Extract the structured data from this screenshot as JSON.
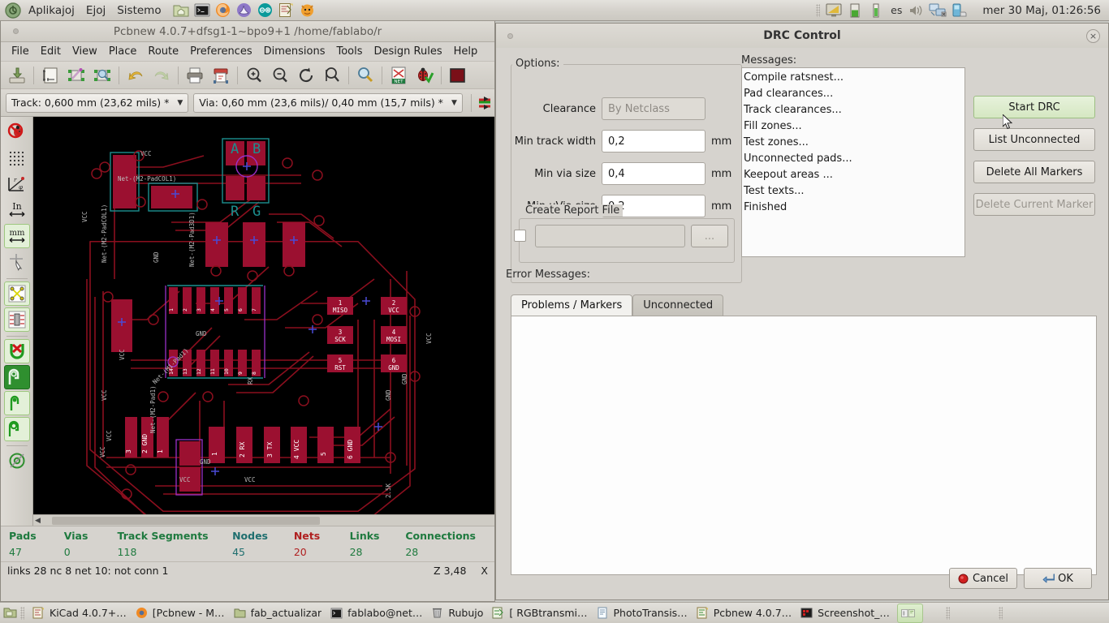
{
  "desktop": {
    "panel": {
      "menus": [
        "Aplikajoj",
        "Ejoj",
        "Sistemo"
      ],
      "launchers": [
        "file-manager-icon",
        "terminal-icon",
        "firefox-icon",
        "inkscape-icon",
        "arduino-icon",
        "kicad-icon",
        "scratch-icon"
      ],
      "tray": [
        "display-icon",
        "battery-icon",
        "power-icon"
      ],
      "keyboard_layout": "es",
      "tray_right": [
        "volume-icon",
        "network-icon",
        "printer-icon"
      ],
      "clock": "mer 30 Maj, 01:26:56"
    }
  },
  "pcbnew": {
    "title": "Pcbnew 4.0.7+dfsg1-1~bpo9+1 /home/fablabo/r",
    "menu": [
      "File",
      "Edit",
      "View",
      "Place",
      "Route",
      "Preferences",
      "Dimensions",
      "Tools",
      "Design Rules",
      "Help"
    ],
    "toolbar": [
      "save-board-icon",
      "board-setup-icon",
      "module-editor-icon",
      "module-viewer-icon",
      "undo-icon",
      "redo-icon",
      "print-icon",
      "plot-icon",
      "zoom-in-icon",
      "zoom-out-icon",
      "zoom-redraw-icon",
      "zoom-fit-icon",
      "find-icon",
      "netlist-icon",
      "drc-icon",
      "layer-color-icon"
    ],
    "track_selector": "Track: 0,600 mm (23,62 mils) *",
    "via_selector": "Via: 0,60 mm (23,6 mils)/ 0,40 mm (15,7 mils) *",
    "left_tools": [
      "drc-off-icon",
      "grid-icon",
      "polar-coord-icon",
      "inch-units-icon",
      "mm-units-icon",
      "cursor-shape-icon",
      "ratsnest-icon",
      "module-ratsnest-icon",
      "autoroute-off-icon",
      "filled-zones-icon",
      "zone-outline-icon",
      "filled-tracks-icon",
      "via-sketch-icon"
    ],
    "status_fields": [
      {
        "label": "Pads",
        "value": "47",
        "color": "#1f7a3f"
      },
      {
        "label": "Vias",
        "value": "0",
        "color": "#1f7a3f"
      },
      {
        "label": "Track Segments",
        "value": "118",
        "color": "#1f7a3f"
      },
      {
        "label": "Nodes",
        "value": "45",
        "color": "#1f6f6f"
      },
      {
        "label": "Nets",
        "value": "20",
        "color": "#b02020"
      },
      {
        "label": "Links",
        "value": "28",
        "color": "#1f7a3f"
      },
      {
        "label": "Connections",
        "value": "28",
        "color": "#1f7a3f"
      }
    ],
    "message_line": "links 28 nc 8  net 10: not conn 1",
    "zoom_readout": "Z 3,48",
    "coord_readout": "X"
  },
  "drc": {
    "title": "DRC Control",
    "close_label": "×",
    "options_label": "Options:",
    "fields": [
      {
        "label": "Clearance",
        "value": "",
        "placeholder": "By Netclass",
        "unit": "",
        "disabled": true
      },
      {
        "label": "Min track width",
        "value": "0,2",
        "placeholder": "",
        "unit": "mm",
        "disabled": false
      },
      {
        "label": "Min via size",
        "value": "0,4",
        "placeholder": "",
        "unit": "mm",
        "disabled": false
      },
      {
        "label": "Min uVia size",
        "value": "0,2",
        "placeholder": "",
        "unit": "mm",
        "disabled": false
      }
    ],
    "report_group_label": "Create Report File",
    "report_checked": false,
    "report_path": "",
    "browse_label": "...",
    "messages_label": "Messages:",
    "messages": [
      "Compile ratsnest...",
      "Pad clearances...",
      "Track clearances...",
      "Fill zones...",
      "Test zones...",
      "Unconnected pads...",
      "Keepout areas ...",
      "Test texts...",
      "Finished"
    ],
    "buttons": [
      {
        "label": "Start DRC",
        "state": "hover"
      },
      {
        "label": "List Unconnected",
        "state": "normal"
      },
      {
        "label": "Delete All Markers",
        "state": "normal"
      },
      {
        "label": "Delete Current Marker",
        "state": "disabled"
      }
    ],
    "error_messages_label": "Error Messages:",
    "tabs": [
      {
        "label": "Problems / Markers",
        "active": true
      },
      {
        "label": "Unconnected",
        "active": false
      }
    ],
    "tab_content": "",
    "cancel_label": "Cancel",
    "ok_label": "OK"
  },
  "taskbar": {
    "items": [
      {
        "label": "KiCad 4.0.7+…",
        "icon": "kicad-icon",
        "active": false
      },
      {
        "label": "[Pcbnew - M…",
        "icon": "firefox-icon",
        "active": false
      },
      {
        "label": "fab_actualizar",
        "icon": "folder-icon",
        "active": false
      },
      {
        "label": "fablabo@net…",
        "icon": "terminal-icon",
        "active": false
      },
      {
        "label": "Rubujo",
        "icon": "trash-icon",
        "active": false
      },
      {
        "label": "[ RGBtransmi…",
        "icon": "eeschema-icon",
        "active": false
      },
      {
        "label": "PhotoTransis…",
        "icon": "document-icon",
        "active": false
      },
      {
        "label": "Pcbnew 4.0.7…",
        "icon": "pcbnew-icon",
        "active": false
      },
      {
        "label": "Screenshot_…",
        "icon": "image-icon",
        "active": false
      },
      {
        "label": "",
        "icon": "pager-icon",
        "active": true
      }
    ]
  },
  "pcb_canvas": {
    "background": "#000000",
    "trace_color": "#8b0f1e",
    "pad_color": "#9b1030",
    "silk_color": "#1c8f8f",
    "net_label_color": "#bdbdbd",
    "via_cross_color": "#4a4ad6",
    "courtyard_color": "#9b30c8",
    "labels": [
      "A",
      "B",
      "R",
      "G",
      "VCC",
      "GND",
      "Net-(M2-PadCOL1)",
      "Net-(M2-PadCOL)",
      "Net-(M2-Pad3D1)",
      "Net-(M1-Pad1)",
      "RX",
      "TX",
      "1 MISO",
      "2 VCC",
      "3 SCK",
      "4 MOSI",
      "5 RST",
      "6 GND",
      "1",
      "2 RX",
      "3 TX",
      "4 VCC",
      "5",
      "6 GND"
    ]
  }
}
